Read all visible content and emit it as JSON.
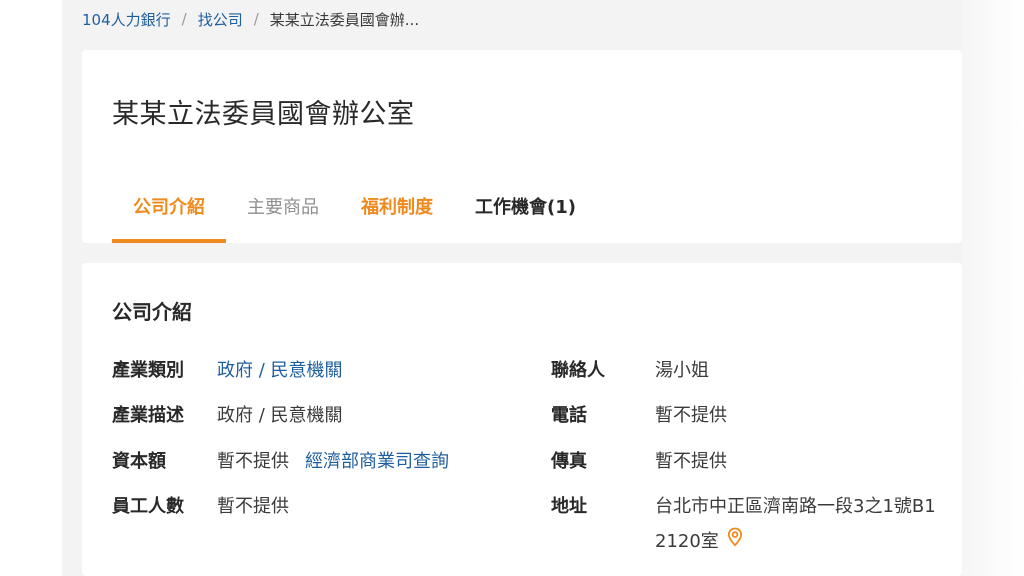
{
  "breadcrumb": {
    "home": "104人力銀行",
    "sep1": "/",
    "find_company": "找公司",
    "sep2": "/",
    "current": "某某立法委員國會辦..."
  },
  "company": {
    "name": "某某立法委員國會辦公室"
  },
  "tabs": [
    {
      "label": "公司介紹",
      "state": "active"
    },
    {
      "label": "主要商品",
      "state": "muted"
    },
    {
      "label": "福利制度",
      "state": "orange"
    },
    {
      "label": "工作機會(1)",
      "state": "normal"
    }
  ],
  "intro": {
    "title": "公司介紹",
    "industry_label": "產業類別",
    "industry_value": "政府 / 民意機關",
    "industry_desc_label": "產業描述",
    "industry_desc_value": "政府 / 民意機關",
    "capital_label": "資本額",
    "capital_value": "暫不提供",
    "capital_link": "經濟部商業司查詢",
    "employees_label": "員工人數",
    "employees_value": "暫不提供",
    "contact_label": "聯絡人",
    "contact_value": "湯小姐",
    "phone_label": "電話",
    "phone_value": "暫不提供",
    "fax_label": "傳真",
    "fax_value": "暫不提供",
    "address_label": "地址",
    "address_line1": "台北市中正區濟南路一段3之1號B1",
    "address_line2": "2120室"
  },
  "colors": {
    "accent": "#ee8a1e",
    "link": "#1f5f9e"
  },
  "icons": {
    "address": "location-pin-icon"
  }
}
